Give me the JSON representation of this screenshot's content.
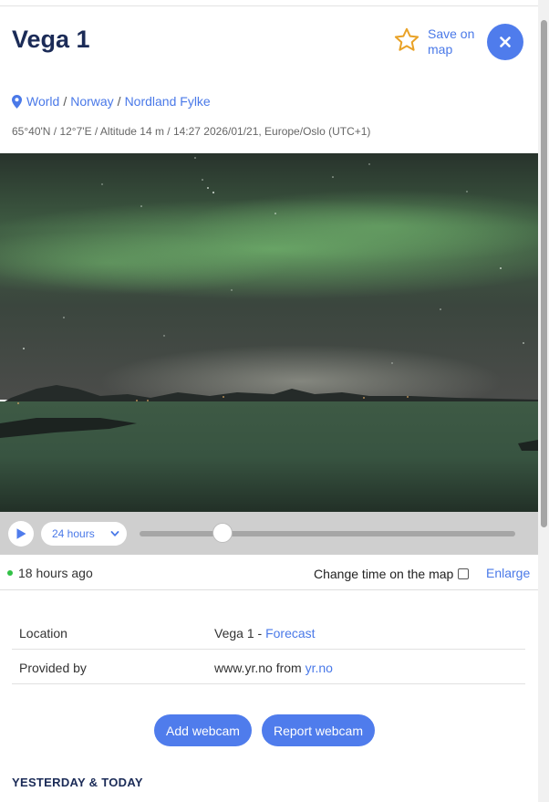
{
  "header": {
    "title": "Vega 1",
    "save_label": "Save on map",
    "close_icon": "close-icon",
    "star_icon": "star-outline-icon",
    "accent_color": "#4f7cec",
    "star_color": "#e9a227"
  },
  "breadcrumb": {
    "items": [
      "World",
      "Norway",
      "Nordland Fylke"
    ],
    "separator": "/"
  },
  "meta": "65°40'N / 12°7'E / Altitude 14 m / 14:27 2026/01/21, Europe/Oslo (UTC+1)",
  "player": {
    "range_label": "24 hours",
    "timeline_position": 0.22
  },
  "status": {
    "age": "18 hours ago",
    "change_time_label": "Change time on the map",
    "change_time_checked": false,
    "enlarge_label": "Enlarge"
  },
  "info": {
    "location_key": "Location",
    "location_value": "Vega 1",
    "location_dash": "-",
    "location_link": "Forecast",
    "provided_key": "Provided by",
    "provided_value": "www.yr.no from",
    "provided_link": "yr.no"
  },
  "actions": {
    "add_label": "Add webcam",
    "report_label": "Report webcam"
  },
  "section": {
    "title": "YESTERDAY & TODAY"
  }
}
